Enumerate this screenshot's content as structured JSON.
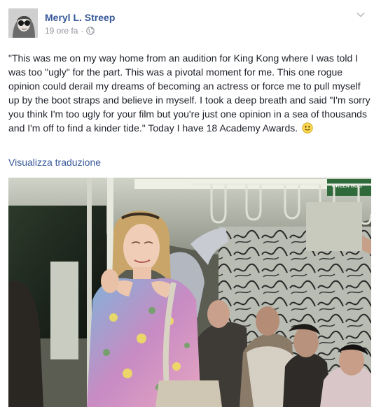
{
  "post": {
    "author": "Meryl L. Streep",
    "time": "19 ore fa",
    "separator": "·",
    "privacy_icon": "globe-icon",
    "menu_icon": "chevron-down-icon",
    "text": "\"This was me on my way home from an audition for King Kong where I was told I was too \"ugly\" for the part. This was a pivotal moment for me. This one rogue opinion could derail my dreams of becoming an actress or force me to pull myself up by the boot straps and believe in myself. I took a deep breath and said \"I'm sorry you think I'm too ugly for your film but you're just one opinion in a sea of thousands and I'm off to find a kinder tide.\" Today I have 18 Academy Awards.",
    "emoji_icon": "smile-icon",
    "translate_link": "Visualizza traduzione",
    "photo_sign_text": "GREEN BOO"
  },
  "colors": {
    "link": "#365899",
    "text": "#1d2129",
    "muted": "#90949c"
  }
}
